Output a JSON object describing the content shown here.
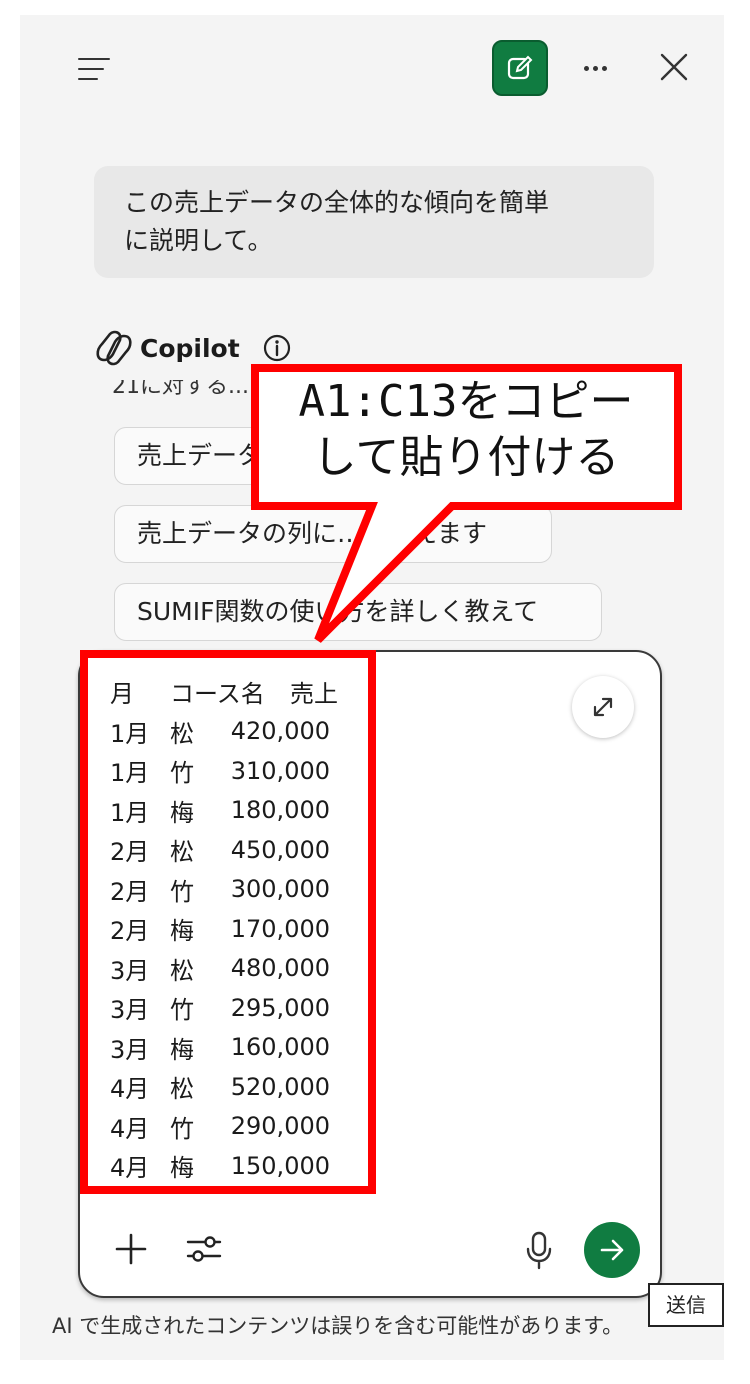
{
  "user_message": {
    "line1": "この売上データの全体的な傾向を簡単",
    "line2": "に説明して。"
  },
  "assistant": {
    "name": "Copilot",
    "truncated_text": "21に対する..."
  },
  "suggestions": [
    {
      "label": "売上データ"
    },
    {
      "label": "売上データの列に…を教えます"
    },
    {
      "label": "SUMIF関数の使い方を詳しく教えて"
    }
  ],
  "pasted": {
    "headers": [
      "月",
      "コース名",
      "売上"
    ],
    "rows": [
      [
        "1月",
        "松",
        "420,000"
      ],
      [
        "1月",
        "竹",
        "310,000"
      ],
      [
        "1月",
        "梅",
        "180,000"
      ],
      [
        "2月",
        "松",
        "450,000"
      ],
      [
        "2月",
        "竹",
        "300,000"
      ],
      [
        "2月",
        "梅",
        "170,000"
      ],
      [
        "3月",
        "松",
        "480,000"
      ],
      [
        "3月",
        "竹",
        "295,000"
      ],
      [
        "3月",
        "梅",
        "160,000"
      ],
      [
        "4月",
        "松",
        "520,000"
      ],
      [
        "4月",
        "竹",
        "290,000"
      ],
      [
        "4月",
        "梅",
        "150,000"
      ]
    ]
  },
  "annotation": {
    "line1": "A1:C13をコピー",
    "line2": "して貼り付ける"
  },
  "tooltip": "送信",
  "disclaimer": "AI で生成されたコンテンツは誤りを含む可能性があります。",
  "icons": {
    "menu": "menu-icon",
    "new_chat": "new-chat-icon",
    "more": "more-icon",
    "close": "close-icon",
    "info": "info-icon",
    "expand": "expand-icon",
    "add": "plus-icon",
    "settings": "sliders-icon",
    "mic": "microphone-icon",
    "send": "arrow-right-icon"
  },
  "colors": {
    "accent_green": "#107c41",
    "annotation_red": "#ff0000",
    "panel_bg": "#f4f4f4"
  }
}
